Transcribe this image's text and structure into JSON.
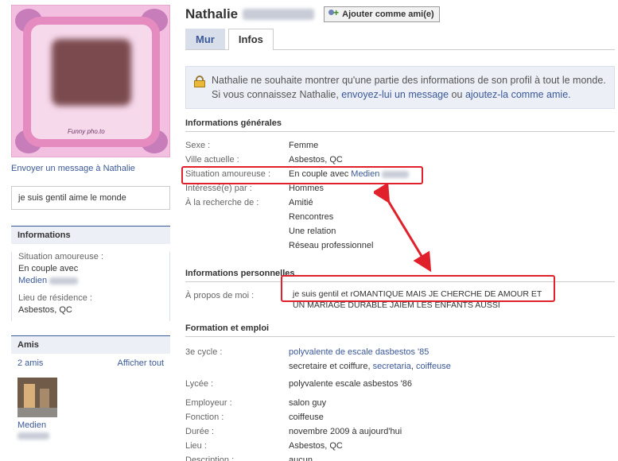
{
  "profile": {
    "first_name": "Nathalie",
    "send_message_link": "Envoyer un message à Nathalie",
    "bio": "je suis gentil aime le monde",
    "picture_caption": "Funny pho.to"
  },
  "header": {
    "add_friend_label": "Ajouter comme ami(e)",
    "tabs": [
      {
        "label": "Mur",
        "active": false
      },
      {
        "label": "Infos",
        "active": true
      }
    ]
  },
  "notice": {
    "part1": "Nathalie ne souhaite montrer qu'une partie des informations de son profil à tout le monde. Si vous connaissez Nathalie, ",
    "link1": "envoyez-lui un message",
    "part2": " ou ",
    "link2": "ajoutez-la comme amie",
    "part3": "."
  },
  "sidebar": {
    "info_title": "Informations",
    "relationship_label": "Situation amoureuse :",
    "relationship_value": "En couple avec",
    "relationship_partner": "Medien",
    "residence_label": "Lieu de résidence :",
    "residence_value": "Asbestos, QC",
    "friends_title": "Amis",
    "friends_count": "2 amis",
    "show_all": "Afficher tout",
    "friend_name": "Medien"
  },
  "general": {
    "title": "Informations générales",
    "sexe_label": "Sexe :",
    "sexe_value": "Femme",
    "city_label": "Ville actuelle :",
    "city_value": "Asbestos, QC",
    "relationship_label": "Situation amoureuse :",
    "relationship_prefix": "En couple avec",
    "relationship_partner": "Medien",
    "interested_label": "Intéressé(e) par :",
    "interested_value": "Hommes",
    "looking_label": "À la recherche de :",
    "looking_values": [
      "Amitié",
      "Rencontres",
      "Une relation",
      "Réseau professionnel"
    ]
  },
  "personal": {
    "title": "Informations personnelles",
    "about_label": "À propos de moi :",
    "about_line1": "je suis gentil et rOMANTIQUE MAIS JE CHERCHE DE AMOUR ET",
    "about_line2": "UN MARIAGE DURABLE JAIEM LES ENFANTS AUSSI"
  },
  "education": {
    "title": "Formation et emploi",
    "cycle_label": "3e cycle :",
    "cycle_school": "polyvalente de escale dasbestos '85",
    "cycle_detail_prefix": "secretaire et coiffure, ",
    "cycle_link1": "secretaria",
    "cycle_sep": ", ",
    "cycle_link2": "coiffeuse",
    "lycee_label": "Lycée :",
    "lycee_value": "polyvalente escale asbestos '86",
    "employer_label": "Employeur :",
    "employer_value": "salon guy",
    "function_label": "Fonction :",
    "function_value": "coiffeuse",
    "duration_label": "Durée :",
    "duration_value": "novembre 2009 à aujourd'hui",
    "place_label": "Lieu :",
    "place_value": "Asbestos, QC",
    "description_label": "Description :",
    "description_value": "aucun"
  },
  "colors": {
    "link": "#3b5998",
    "highlight": "#e0202a",
    "panel": "#eceff5"
  }
}
